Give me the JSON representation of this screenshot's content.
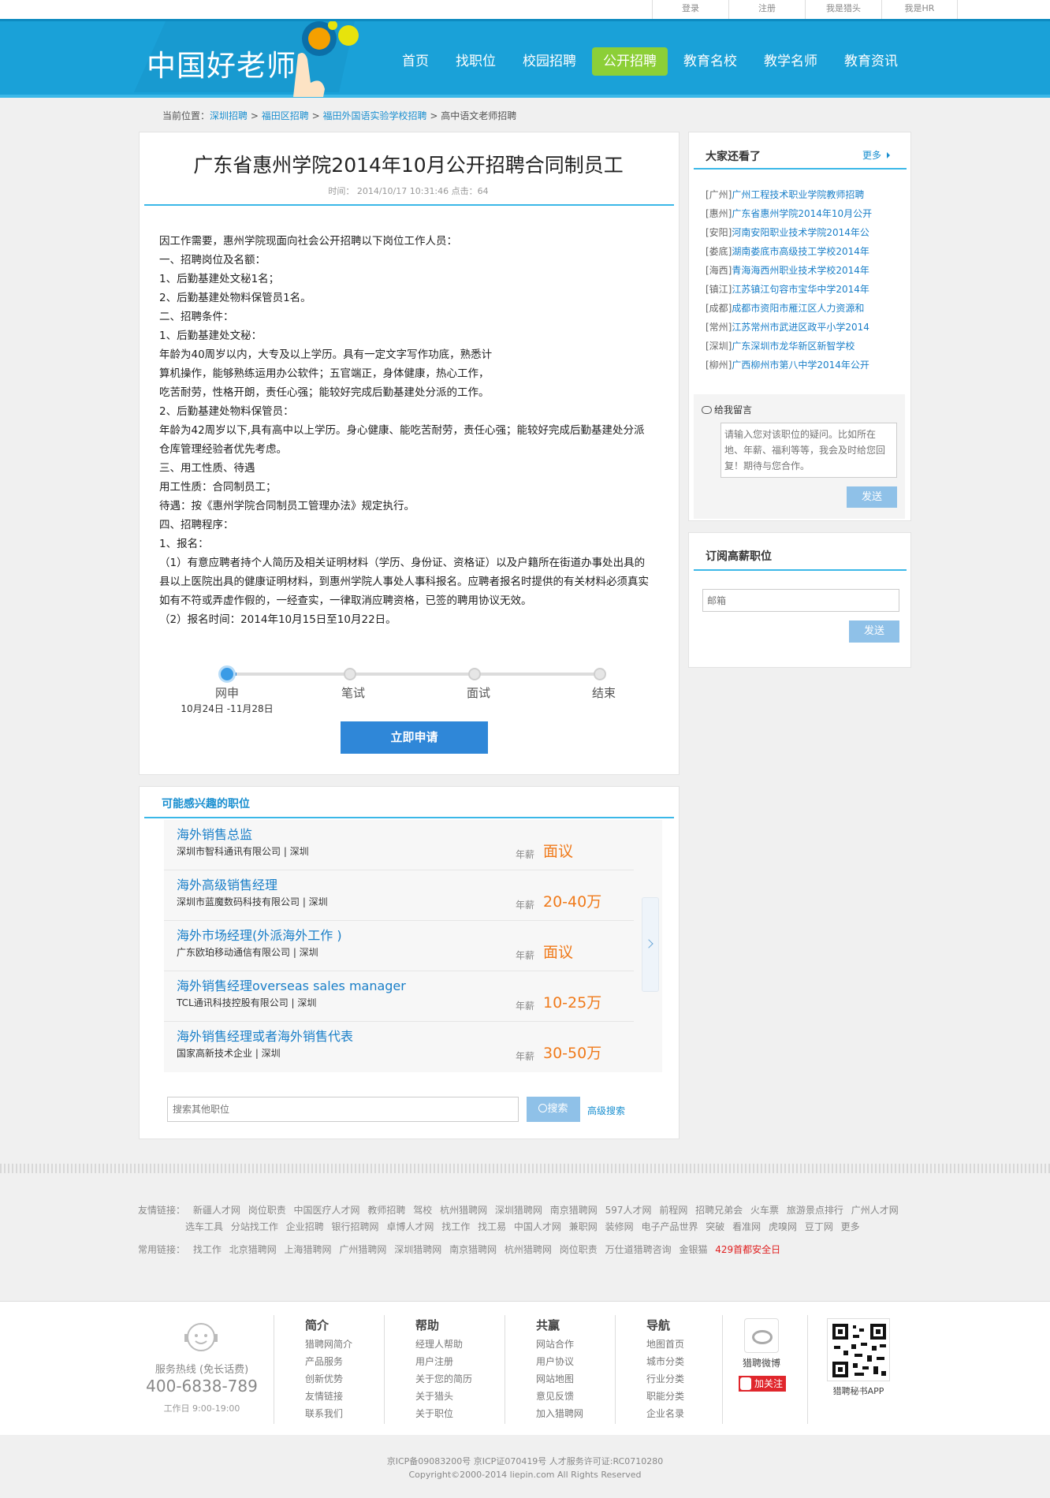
{
  "top_links": [
    "登录",
    "注册",
    "我是猎头",
    "我是HR"
  ],
  "brand": {
    "logo_text": "中国好老师",
    "accent": "#1aa1d8",
    "active_nav": "#8ccf37"
  },
  "nav": [
    "首页",
    "找职位",
    "校园招聘",
    "公开招聘",
    "教育名校",
    "教学名师",
    "教育资讯"
  ],
  "breadcrumb": {
    "prefix": "当前位置：",
    "items": [
      "深圳招聘",
      "福田区招聘",
      "福田外国语实验学校招聘"
    ],
    "current": "高中语文老师招聘",
    "sep": ">"
  },
  "article": {
    "title": "广东省惠州学院2014年10月公开招聘合同制员工",
    "meta": "时间： 2014/10/17 10:31:46 点击：64",
    "lines": [
      "因工作需要，惠州学院现面向社会公开招聘以下岗位工作人员：",
      "一、招聘岗位及名额：",
      "1、后勤基建处文秘1名；",
      "2、后勤基建处物料保管员1名。",
      "二、招聘条件：",
      "1、后勤基建处文秘：",
      "年龄为40周岁以内，大专及以上学历。具有一定文字写作功底，熟悉计",
      "算机操作，能够熟练运用办公软件；五官端正，身体健康，热心工作，",
      "吃苦耐劳，性格开朗，责任心强；能较好完成后勤基建处分派的工作。",
      "2、后勤基建处物料保管员：",
      "年龄为42周岁以下,具有高中以上学历。身心健康、能吃苦耐劳，责任心强；能较好完成后勤基建处分派",
      "仓库管理经验者优先考虑。",
      "三、用工性质、待遇",
      "用工性质：合同制员工；",
      "待遇：按《惠州学院合同制员工管理办法》规定执行。",
      "四、招聘程序：",
      "1、报名：",
      "（1）有意应聘者持个人简历及相关证明材料（学历、身份证、资格证）以及户籍所在街道办事处出具的",
      "县以上医院出具的健康证明材料，到惠州学院人事处人事科报名。应聘者报名时提供的有关材料必须真实",
      "如有不符或弄虚作假的，一经查实，一律取消应聘资格，已签的聘用协议无效。",
      "（2）报名时间：2014年10月15日至10月22日。"
    ]
  },
  "steps": {
    "labels": [
      "网申",
      "笔试",
      "面试",
      "结束"
    ],
    "current_date": "10月24日 -11月28日",
    "apply_button": "立即申请"
  },
  "related": {
    "title": "可能感兴趣的职位",
    "salary_label": "年薪",
    "jobs": [
      {
        "title": "海外销售总监",
        "company": "深圳市智科通讯有限公司 | 深圳",
        "salary": "面议"
      },
      {
        "title": "海外高级销售经理",
        "company": "深圳市蓝魔数码科技有限公司 | 深圳",
        "salary": "20-40万"
      },
      {
        "title": "海外市场经理(外派海外工作 )",
        "company": "广东欧珀移动通信有限公司 | 深圳",
        "salary": "面议"
      },
      {
        "title": "海外销售经理overseas sales manager",
        "company": "TCL通讯科技控股有限公司 | 深圳",
        "salary": "10-25万"
      },
      {
        "title": "海外销售经理或者海外销售代表",
        "company": "国家高新技术企业 | 深圳",
        "salary": "30-50万"
      }
    ],
    "search_placeholder": "搜索其他职位",
    "search_button": "搜索",
    "advanced": "高级搜索"
  },
  "sidebar": {
    "viewed_title": "大家还看了",
    "more": "更多",
    "viewed": [
      {
        "city": "[广州]",
        "text": "广州工程技术职业学院教师招聘"
      },
      {
        "city": "[惠州]",
        "text": "广东省惠州学院2014年10月公开"
      },
      {
        "city": "[安阳]",
        "text": "河南安阳职业技术学院2014年公"
      },
      {
        "city": "[娄底]",
        "text": "湖南娄底市高级技工学校2014年"
      },
      {
        "city": "[海西]",
        "text": "青海海西州职业技术学校2014年"
      },
      {
        "city": "[镇江]",
        "text": "江苏镇江句容市宝华中学2014年"
      },
      {
        "city": "[成都]",
        "text": "成都市资阳市雁江区人力资源和"
      },
      {
        "city": "[常州]",
        "text": "江苏常州市武进区政平小学2014"
      },
      {
        "city": "[深圳]",
        "text": "广东深圳市龙华新区新智学校"
      },
      {
        "city": "[柳州]",
        "text": "广西柳州市第八中学2014年公开"
      }
    ],
    "message_title": "给我留言",
    "message_placeholder": "请输入您对该职位的疑问。比如所在地、年薪、福利等等，我会及时给您回复！期待与您合作。",
    "send": "发送",
    "subscribe_title": "订阅高薪职位",
    "email_placeholder": "邮箱",
    "send2": "发送"
  },
  "friend_links": {
    "label1": "友情链接：",
    "row1": [
      "新疆人才网",
      "岗位职责",
      "中国医疗人才网",
      "教师招聘",
      "驾校",
      "杭州猎聘网",
      "深圳猎聘网",
      "南京猎聘网",
      "597人才网",
      "前程网",
      "招聘兄弟会",
      "火车票",
      "旅游景点排行",
      "广州人才网"
    ],
    "row2": [
      "选车工具",
      "分站找工作",
      "企业招聘",
      "银行招聘网",
      "卓博人才网",
      "找工作",
      "找工易",
      "中国人才网",
      "兼职网",
      "装修网",
      "电子产品世界",
      "突破",
      "看准网",
      "虎嗅网",
      "豆丁网",
      "更多"
    ],
    "label2": "常用链接：",
    "row3": [
      "找工作",
      "北京猎聘网",
      "上海猎聘网",
      "广州猎聘网",
      "深圳猎聘网",
      "南京猎聘网",
      "杭州猎聘网",
      "岗位职责",
      "万仕道猎聘咨询",
      "金银猫"
    ],
    "highlight": "429首都安全日"
  },
  "footer": {
    "hotline_label": "服务热线 (免长话费)",
    "phone": "400-6838-789",
    "hours": "工作日 9:00-19:00",
    "cols": [
      {
        "h": "简介",
        "items": [
          "猎聘网简介",
          "产品服务",
          "创新优势",
          "友情链接",
          "联系我们"
        ]
      },
      {
        "h": "帮助",
        "items": [
          "经理人帮助",
          "用户注册",
          "关于您的简历",
          "关于猎头",
          "关于职位"
        ]
      },
      {
        "h": "共赢",
        "items": [
          "网站合作",
          "用户协议",
          "网站地图",
          "意见反馈",
          "加入猎聘网"
        ]
      },
      {
        "h": "导航",
        "items": [
          "地图首页",
          "城市分类",
          "行业分类",
          "职能分类",
          "企业名录"
        ]
      }
    ],
    "weibo": "猎聘微博",
    "follow": "加关注",
    "app": "猎聘秘书APP",
    "icp": "京ICP备09083200号 京ICP证070419号 人才服务许可证:RC0710280",
    "copyright": "Copyright©2000-2014 liepin.com All Rights Reserved"
  }
}
